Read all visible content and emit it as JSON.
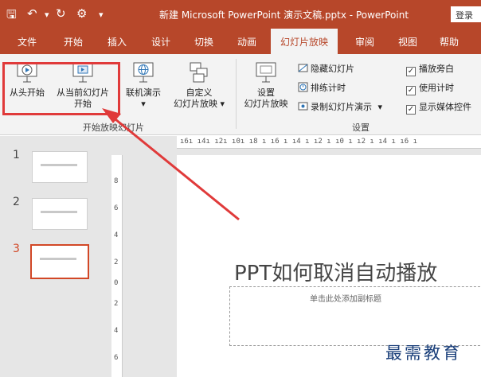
{
  "window": {
    "title": "新建 Microsoft PowerPoint 演示文稿.pptx  -  PowerPoint",
    "signin": "登录"
  },
  "qat": {
    "icons": [
      "save-icon",
      "undo-icon",
      "redo-icon",
      "customize-icon",
      "more-icon"
    ]
  },
  "tabs": [
    "文件",
    "开始",
    "插入",
    "设计",
    "切换",
    "动画",
    "幻灯片放映",
    "审阅",
    "视图",
    "帮助"
  ],
  "active_tab": "幻灯片放映",
  "ribbon": {
    "from_beginning": "从头开始",
    "from_current_l1": "从当前幻灯片",
    "from_current_l2": "开始",
    "online_present": "联机演示",
    "custom_l1": "自定义",
    "custom_l2": "幻灯片放映",
    "group_start": "开始放映幻灯片",
    "setup_l1": "设置",
    "setup_l2": "幻灯片放映",
    "hide_slide": "隐藏幻灯片",
    "rehearse": "排练计时",
    "record": "录制幻灯片演示",
    "group_setup": "设置",
    "play_narration": "播放旁白",
    "use_timings": "使用计时",
    "show_media_controls": "显示媒体控件",
    "chevron": "▾"
  },
  "thumbnails": [
    {
      "num": "1"
    },
    {
      "num": "2"
    },
    {
      "num": "3"
    }
  ],
  "ruler": {
    "horizontal": "ı6ı ı4ı ı2ı ı0ı ı8 ı ı6 ı ı4 ı ı2 ı ı0 ı ı2 ı ı4 ı ı6 ı",
    "vertical": [
      "8",
      "6",
      "4",
      "2",
      "0",
      "2",
      "4",
      "6"
    ]
  },
  "slide": {
    "title": "PPT如何取消自动播放",
    "subtitle_placeholder": "单击此处添加副标题"
  },
  "watermark": "最需教育",
  "colors": {
    "accent": "#b7472a",
    "highlight": "#e03a3a"
  }
}
